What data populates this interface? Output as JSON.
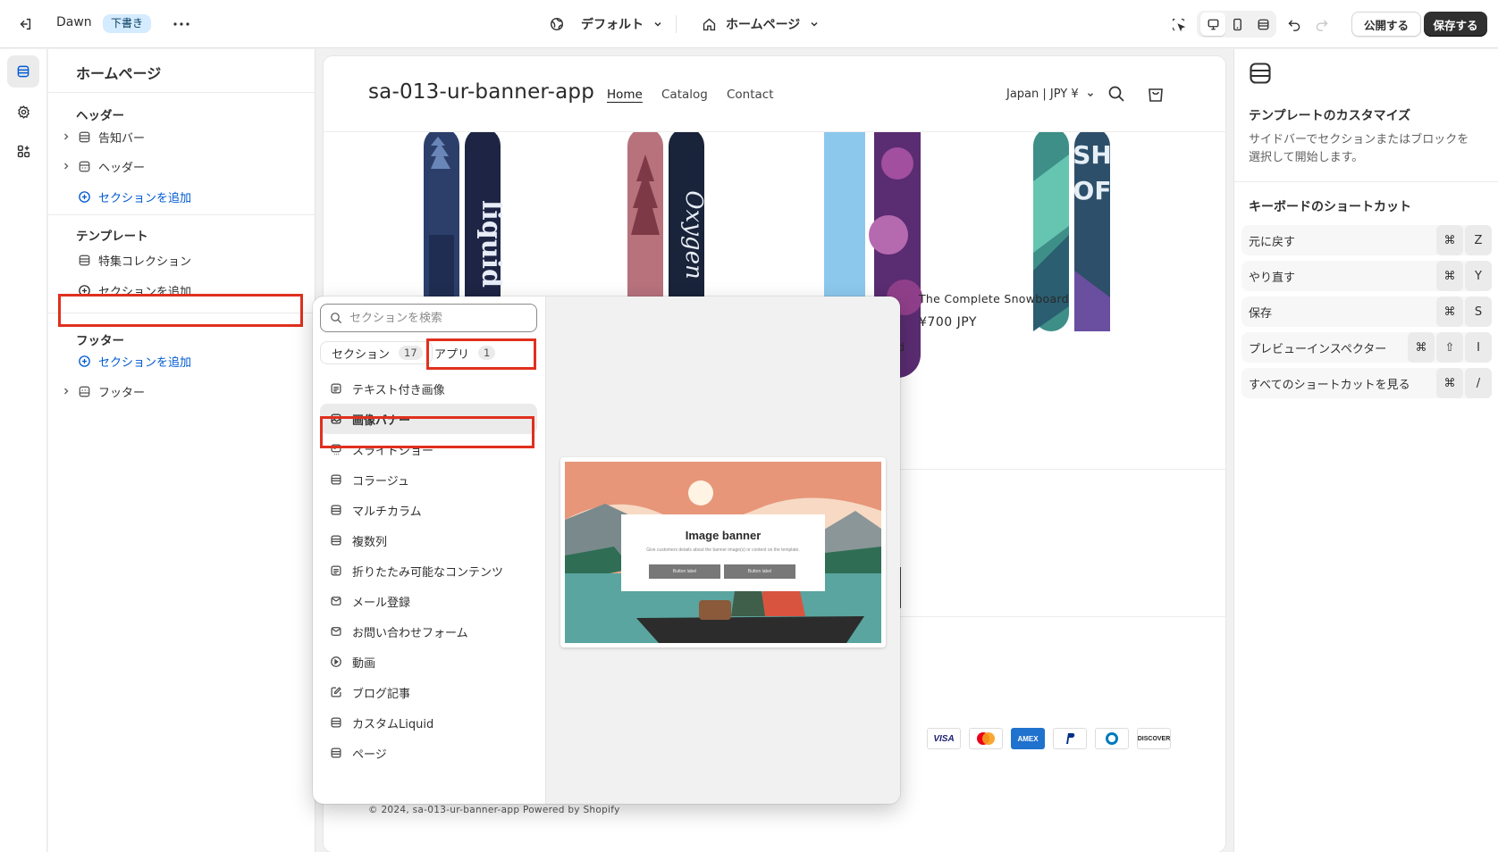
{
  "topbar": {
    "theme_name": "Dawn",
    "status_badge": "下書き",
    "theme_select": "デフォルト",
    "page_select": "ホームページ",
    "publish_label": "公開する",
    "save_label": "保存する"
  },
  "sidebar": {
    "title": "ホームページ",
    "header_group": "ヘッダー",
    "header_items": [
      "告知バー",
      "ヘッダー"
    ],
    "template_group": "テンプレート",
    "template_items": [
      "特集コレクション"
    ],
    "footer_group": "フッター",
    "footer_items": [
      "フッター"
    ],
    "add_section": "セクションを追加"
  },
  "preview": {
    "store_name": "sa-013-ur-banner-app",
    "nav": [
      "Home",
      "Catalog",
      "Contact"
    ],
    "country": "Japan | JPY ¥",
    "product_title": "The Complete Snowboard",
    "product_price": "¥700 JPY",
    "partial_product": "nowboard",
    "copyright": "© 2024, sa-013-ur-banner-app Powered by Shopify",
    "payments": [
      "VISA",
      "Mastercard",
      "AMEX",
      "PayPal",
      "Diners",
      "DISCOVER"
    ]
  },
  "picker": {
    "search_placeholder": "セクションを検索",
    "tab_sections": "セクション",
    "tab_sections_count": "17",
    "tab_apps": "アプリ",
    "tab_apps_count": "1",
    "items": [
      "テキスト付き画像",
      "画像バナー",
      "スライドショー",
      "コラージュ",
      "マルチカラム",
      "複数列",
      "折りたたみ可能なコンテンツ",
      "メール登録",
      "お問い合わせフォーム",
      "動画",
      "ブログ記事",
      "カスタムLiquid",
      "ページ"
    ],
    "thumb_title": "Image banner",
    "thumb_text": "Give customers details about the banner image(s) or content on the template.",
    "thumb_button": "Button label"
  },
  "rpanel": {
    "title": "テンプレートのカスタマイズ",
    "desc": "サイドバーでセクションまたはブロックを選択して開始します。",
    "kb_title": "キーボードのショートカット",
    "shortcuts": [
      {
        "label": "元に戻す",
        "keys": [
          "⌘",
          "Z"
        ]
      },
      {
        "label": "やり直す",
        "keys": [
          "⌘",
          "Y"
        ]
      },
      {
        "label": "保存",
        "keys": [
          "⌘",
          "S"
        ]
      },
      {
        "label": "プレビューインスペクター",
        "keys": [
          "⌘",
          "⇧",
          "I"
        ]
      },
      {
        "label": "すべてのショートカットを見る",
        "keys": [
          "⌘",
          "/"
        ]
      }
    ]
  },
  "colors": {
    "accent": "#005bd3",
    "highlight": "#e0301e",
    "primary_button": "#303030"
  }
}
